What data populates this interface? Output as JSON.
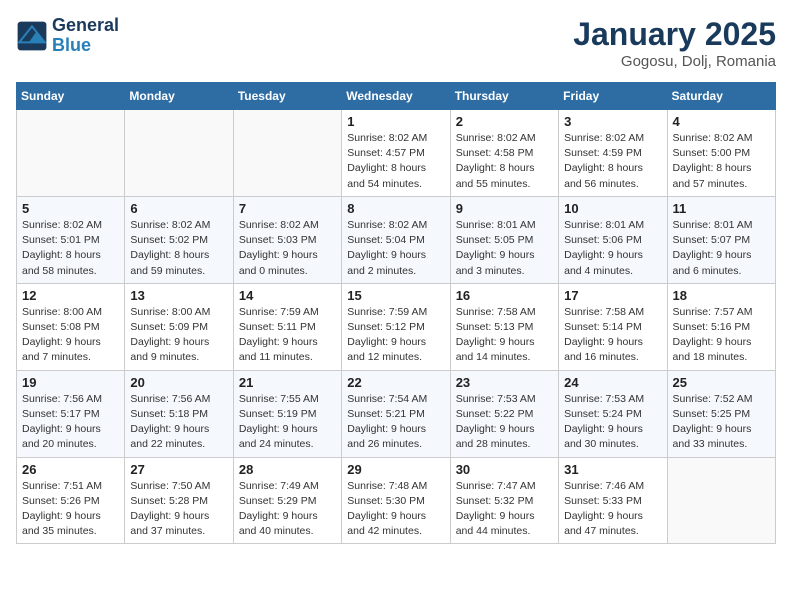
{
  "header": {
    "logo_line1": "General",
    "logo_line2": "Blue",
    "title": "January 2025",
    "subtitle": "Gogosu, Dolj, Romania"
  },
  "days_of_week": [
    "Sunday",
    "Monday",
    "Tuesday",
    "Wednesday",
    "Thursday",
    "Friday",
    "Saturday"
  ],
  "weeks": [
    [
      {
        "num": "",
        "info": ""
      },
      {
        "num": "",
        "info": ""
      },
      {
        "num": "",
        "info": ""
      },
      {
        "num": "1",
        "info": "Sunrise: 8:02 AM\nSunset: 4:57 PM\nDaylight: 8 hours\nand 54 minutes."
      },
      {
        "num": "2",
        "info": "Sunrise: 8:02 AM\nSunset: 4:58 PM\nDaylight: 8 hours\nand 55 minutes."
      },
      {
        "num": "3",
        "info": "Sunrise: 8:02 AM\nSunset: 4:59 PM\nDaylight: 8 hours\nand 56 minutes."
      },
      {
        "num": "4",
        "info": "Sunrise: 8:02 AM\nSunset: 5:00 PM\nDaylight: 8 hours\nand 57 minutes."
      }
    ],
    [
      {
        "num": "5",
        "info": "Sunrise: 8:02 AM\nSunset: 5:01 PM\nDaylight: 8 hours\nand 58 minutes."
      },
      {
        "num": "6",
        "info": "Sunrise: 8:02 AM\nSunset: 5:02 PM\nDaylight: 8 hours\nand 59 minutes."
      },
      {
        "num": "7",
        "info": "Sunrise: 8:02 AM\nSunset: 5:03 PM\nDaylight: 9 hours\nand 0 minutes."
      },
      {
        "num": "8",
        "info": "Sunrise: 8:02 AM\nSunset: 5:04 PM\nDaylight: 9 hours\nand 2 minutes."
      },
      {
        "num": "9",
        "info": "Sunrise: 8:01 AM\nSunset: 5:05 PM\nDaylight: 9 hours\nand 3 minutes."
      },
      {
        "num": "10",
        "info": "Sunrise: 8:01 AM\nSunset: 5:06 PM\nDaylight: 9 hours\nand 4 minutes."
      },
      {
        "num": "11",
        "info": "Sunrise: 8:01 AM\nSunset: 5:07 PM\nDaylight: 9 hours\nand 6 minutes."
      }
    ],
    [
      {
        "num": "12",
        "info": "Sunrise: 8:00 AM\nSunset: 5:08 PM\nDaylight: 9 hours\nand 7 minutes."
      },
      {
        "num": "13",
        "info": "Sunrise: 8:00 AM\nSunset: 5:09 PM\nDaylight: 9 hours\nand 9 minutes."
      },
      {
        "num": "14",
        "info": "Sunrise: 7:59 AM\nSunset: 5:11 PM\nDaylight: 9 hours\nand 11 minutes."
      },
      {
        "num": "15",
        "info": "Sunrise: 7:59 AM\nSunset: 5:12 PM\nDaylight: 9 hours\nand 12 minutes."
      },
      {
        "num": "16",
        "info": "Sunrise: 7:58 AM\nSunset: 5:13 PM\nDaylight: 9 hours\nand 14 minutes."
      },
      {
        "num": "17",
        "info": "Sunrise: 7:58 AM\nSunset: 5:14 PM\nDaylight: 9 hours\nand 16 minutes."
      },
      {
        "num": "18",
        "info": "Sunrise: 7:57 AM\nSunset: 5:16 PM\nDaylight: 9 hours\nand 18 minutes."
      }
    ],
    [
      {
        "num": "19",
        "info": "Sunrise: 7:56 AM\nSunset: 5:17 PM\nDaylight: 9 hours\nand 20 minutes."
      },
      {
        "num": "20",
        "info": "Sunrise: 7:56 AM\nSunset: 5:18 PM\nDaylight: 9 hours\nand 22 minutes."
      },
      {
        "num": "21",
        "info": "Sunrise: 7:55 AM\nSunset: 5:19 PM\nDaylight: 9 hours\nand 24 minutes."
      },
      {
        "num": "22",
        "info": "Sunrise: 7:54 AM\nSunset: 5:21 PM\nDaylight: 9 hours\nand 26 minutes."
      },
      {
        "num": "23",
        "info": "Sunrise: 7:53 AM\nSunset: 5:22 PM\nDaylight: 9 hours\nand 28 minutes."
      },
      {
        "num": "24",
        "info": "Sunrise: 7:53 AM\nSunset: 5:24 PM\nDaylight: 9 hours\nand 30 minutes."
      },
      {
        "num": "25",
        "info": "Sunrise: 7:52 AM\nSunset: 5:25 PM\nDaylight: 9 hours\nand 33 minutes."
      }
    ],
    [
      {
        "num": "26",
        "info": "Sunrise: 7:51 AM\nSunset: 5:26 PM\nDaylight: 9 hours\nand 35 minutes."
      },
      {
        "num": "27",
        "info": "Sunrise: 7:50 AM\nSunset: 5:28 PM\nDaylight: 9 hours\nand 37 minutes."
      },
      {
        "num": "28",
        "info": "Sunrise: 7:49 AM\nSunset: 5:29 PM\nDaylight: 9 hours\nand 40 minutes."
      },
      {
        "num": "29",
        "info": "Sunrise: 7:48 AM\nSunset: 5:30 PM\nDaylight: 9 hours\nand 42 minutes."
      },
      {
        "num": "30",
        "info": "Sunrise: 7:47 AM\nSunset: 5:32 PM\nDaylight: 9 hours\nand 44 minutes."
      },
      {
        "num": "31",
        "info": "Sunrise: 7:46 AM\nSunset: 5:33 PM\nDaylight: 9 hours\nand 47 minutes."
      },
      {
        "num": "",
        "info": ""
      }
    ]
  ]
}
